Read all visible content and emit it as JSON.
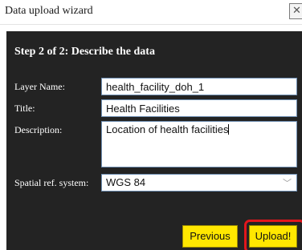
{
  "dialog": {
    "title": "Data upload wizard",
    "close_icon": "close-icon"
  },
  "step": {
    "heading": "Step 2 of 2: Describe the data"
  },
  "form": {
    "layer_name": {
      "label": "Layer Name:",
      "value": "health_facility_doh_1"
    },
    "title": {
      "label": "Title:",
      "value": "Health Facilities"
    },
    "description": {
      "label": "Description:",
      "value": "Location of health facilities"
    },
    "srs": {
      "label": "Spatial ref. system:",
      "value": "WGS 84",
      "icon": "chevron-down-icon"
    }
  },
  "buttons": {
    "previous": "Previous",
    "upload": "Upload!"
  },
  "colors": {
    "panel_bg": "#232323",
    "button_bg": "#ffe700",
    "highlight": "#e2161c",
    "input_border": "#6f8fb3"
  }
}
